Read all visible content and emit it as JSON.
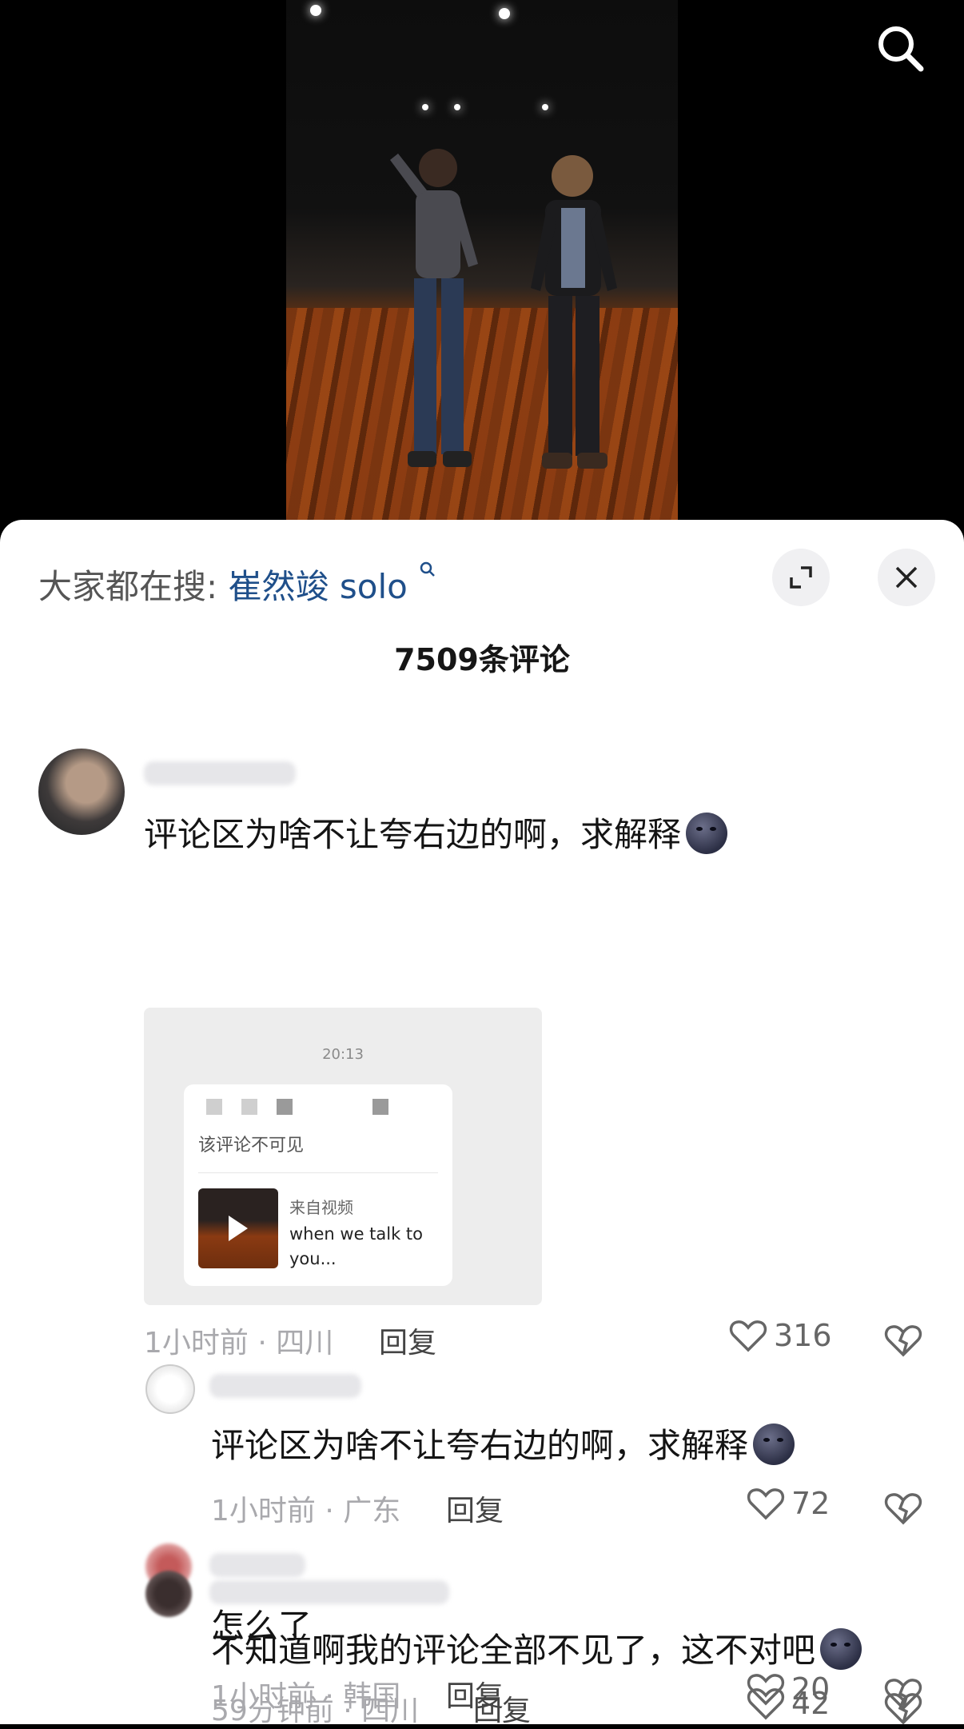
{
  "top_bar": {
    "search_icon": "search-icon"
  },
  "sheet": {
    "everyone_search_prefix": "大家都在搜:",
    "everyone_search_keyword": "崔然竣 solo",
    "expand_icon": "expand-icon",
    "close_icon": "close-icon",
    "comment_count": "7509条评论"
  },
  "comments": [
    {
      "text": "评论区为啥不让夸右边的啊，求解释",
      "emoji": "moon-face",
      "time_location": "1小时前 · 四川",
      "reply_label": "回复",
      "likes": "316",
      "attachment": {
        "time": "20:13",
        "notice": "该评论不可见",
        "from_label": "来自视频",
        "video_title": "when we talk to you..."
      }
    },
    {
      "text": "评论区为啥不让夸右边的啊，求解释",
      "emoji": "moon-face",
      "time_location": "1小时前 · 广东",
      "reply_label": "回复",
      "likes": "72"
    },
    {
      "text": "怎么了",
      "time_location": "1小时前 · 韩国",
      "reply_label": "回复",
      "likes": "20"
    },
    {
      "text": "不知道啊我的评论全部不见了，这不对吧",
      "emoji": "moon-face",
      "time_location": "59分钟前 · 四川",
      "reply_label": "回复",
      "likes": "42"
    }
  ],
  "colors": {
    "keyword_blue": "#1f4f8a",
    "meta_gray": "#a9a9ad",
    "sheet_bg": "#ffffff"
  }
}
